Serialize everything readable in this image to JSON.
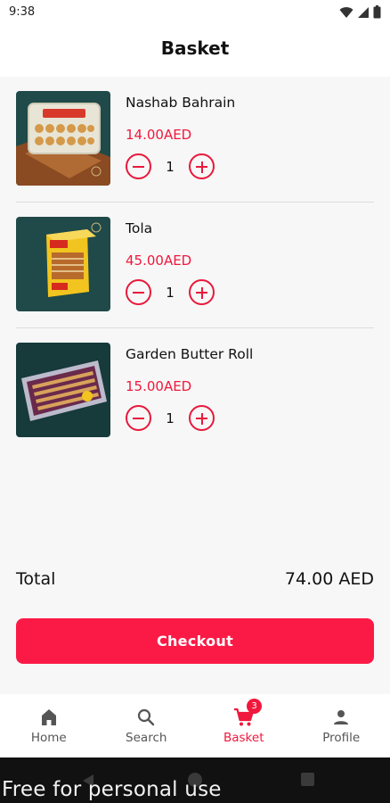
{
  "status_bar": {
    "time": "9:38"
  },
  "header": {
    "title": "Basket"
  },
  "items": [
    {
      "name": "Nashab Bahrain",
      "price": "14.00AED",
      "quantity": "1",
      "image_icon": "product-image-nashab-bahrain"
    },
    {
      "name": "Tola",
      "price": "45.00AED",
      "quantity": "1",
      "image_icon": "product-image-tola"
    },
    {
      "name": "Garden Butter Roll",
      "price": "15.00AED",
      "quantity": "1",
      "image_icon": "product-image-garden-butter-roll"
    }
  ],
  "total": {
    "label": "Total",
    "value": "74.00 AED"
  },
  "checkout": {
    "label": "Checkout"
  },
  "nav": {
    "items": [
      {
        "label": "Home",
        "icon": "home-icon"
      },
      {
        "label": "Search",
        "icon": "search-icon"
      },
      {
        "label": "Basket",
        "icon": "cart-icon",
        "badge": "3",
        "active": true
      },
      {
        "label": "Profile",
        "icon": "profile-icon"
      }
    ]
  },
  "watermark": "Free for personal use",
  "colors": {
    "accent": "#fb1a46",
    "price": "#f0183c",
    "background": "#f7f7f7"
  }
}
